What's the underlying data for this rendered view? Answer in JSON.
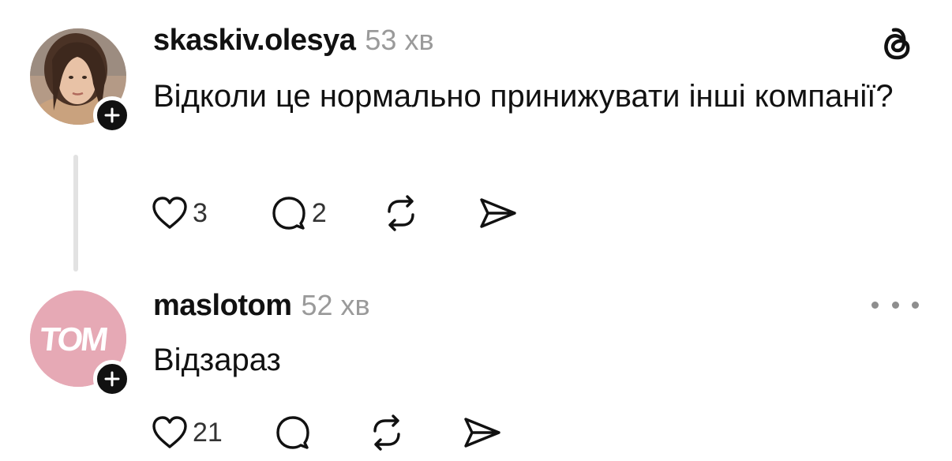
{
  "posts": [
    {
      "username": "skaskiv.olesya",
      "time": "53 хв",
      "text": "Відколи це нормально принижувати інші компанії?",
      "likes": "3",
      "replies": "2"
    },
    {
      "username": "maslotom",
      "time": "52 хв",
      "text": "Відзараз",
      "avatar_logo": "TOM",
      "likes": "21"
    }
  ],
  "icons": {
    "like": "heart-icon",
    "reply": "speech-bubble-icon",
    "repost": "repost-icon",
    "share": "send-icon",
    "follow": "plus-icon",
    "app": "threads-logo-icon",
    "more": "more-horizontal-icon"
  },
  "colors": {
    "text": "#111111",
    "muted": "#9a9a9a",
    "avatar_pink": "#e6a9b5",
    "thread_line": "#e2e2e2"
  }
}
